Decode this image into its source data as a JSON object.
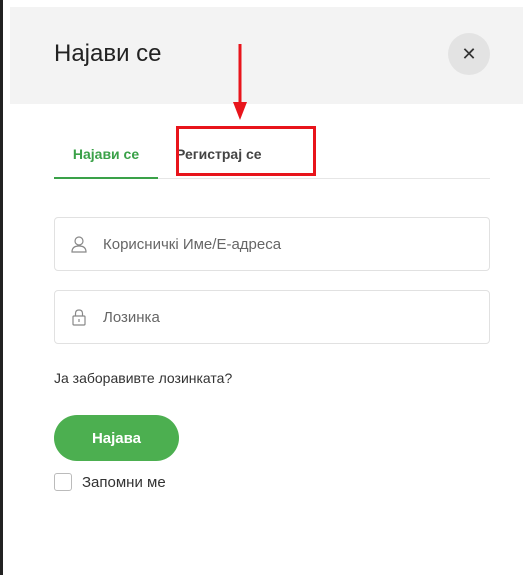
{
  "modal": {
    "title": "Најави се",
    "close_glyph": "✕"
  },
  "tabs": [
    {
      "label": "Најави се",
      "active": true
    },
    {
      "label": "Регистрај се",
      "active": false
    }
  ],
  "form": {
    "username_placeholder": "Корисничкі Име/Е-адреса",
    "password_placeholder": "Лозинка",
    "forgot_link": "Ја заборавивте лозинката?",
    "submit_label": "Најава",
    "remember_label": "Запомни ме"
  },
  "colors": {
    "accent": "#3aa148",
    "button": "#4caf50",
    "annotation": "#e8141b"
  },
  "icons": {
    "user": "user-icon",
    "lock": "lock-icon",
    "close": "close-icon"
  }
}
